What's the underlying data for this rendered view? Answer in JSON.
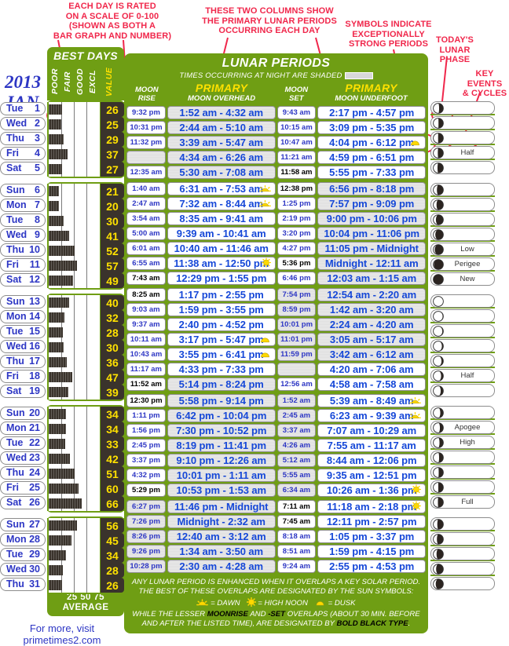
{
  "annotations": [
    {
      "id": "rating-note",
      "text": "EACH DAY IS RATED\nON A SCALE OF 0-100\n(SHOWN AS BOTH A\nBAR GRAPH AND NUMBER)"
    },
    {
      "id": "columns-note",
      "text": "THESE TWO COLUMNS SHOW\nTHE PRIMARY LUNAR PERIODS\nOCCURRING EACH DAY"
    },
    {
      "id": "symbols-note",
      "text": "SYMBOLS INDICATE\nEXCEPTIONALLY\nSTRONG PERIODS"
    },
    {
      "id": "todays-phase-note",
      "text": "TODAY'S\nLUNAR\nPHASE"
    },
    {
      "id": "key-events-note",
      "text": "KEY\nEVENTS\n& CYCLES"
    }
  ],
  "left": {
    "year": "2013",
    "month": "JAN",
    "best_days_title": "BEST DAYS",
    "column_headers": [
      "POOR",
      "FAIR",
      "GOOD",
      "EXCL",
      "VALUE"
    ],
    "axis_labels": "25 50 75",
    "axis_caption": "AVERAGE",
    "footer_line1": "For more, visit",
    "footer_line2": "primetimes2.com"
  },
  "main": {
    "title": "LUNAR PERIODS",
    "subtitle": "TIMES OCCURRING AT NIGHT ARE SHADED",
    "headers": {
      "moon_rise": "MOON\nRISE",
      "moon_rise_l1": "MOON",
      "moon_rise_l2": "RISE",
      "overhead_big": "PRIMARY",
      "overhead_small": "MOON OVERHEAD",
      "moon_set_l1": "MOON",
      "moon_set_l2": "SET",
      "underfoot_big": "PRIMARY",
      "underfoot_small": "MOON UNDERFOOT"
    },
    "footnote_line1": "ANY LUNAR PERIOD IS ENHANCED WHEN IT OVERLAPS A KEY SOLAR PERIOD.",
    "footnote_line2": "THE BEST OF THESE OVERLAPS ARE DESIGNATED BY THE SUN SYMBOLS:",
    "legend_dawn": "= DAWN",
    "legend_noon": "= HIGH NOON",
    "legend_dusk": "= DUSK",
    "footnote_line3a": "WHILE THE LESSER ",
    "footnote_line3b": "MOONRISE",
    "footnote_line3c": " AND ",
    "footnote_line3d": "-SET",
    "footnote_line3e": " OVERLAPS (ABOUT 30 MIN. BEFORE",
    "footnote_line4a": "AND AFTER THE LISTED TIME), ARE DESIGNATED BY ",
    "footnote_line4b": "BOLD BLACK TYPE",
    "footnote_line4c": "."
  },
  "colors": {
    "green": "#6f9e14",
    "red_annotation": "#f0274b",
    "blue_text": "#1648d8",
    "dark_bar": "#3a332c",
    "yellow_value": "#ffe100",
    "shade_gray": "#dedede"
  },
  "weeks": [
    {
      "days": [
        {
          "day": "Tue",
          "num": "1",
          "value": 26,
          "rise": "9:32 pm",
          "rise_bold": false,
          "rise_shaded": false,
          "overhead": "1:52 am - 4:32 am",
          "overhead_shaded": true,
          "overhead_sym": "",
          "set": "9:43 am",
          "set_bold": false,
          "set_shaded": false,
          "underfoot": "2:17 pm - 4:57 pm",
          "underfoot_shaded": false,
          "underfoot_sym": "",
          "phase": 0.58,
          "event": ""
        },
        {
          "day": "Wed",
          "num": "2",
          "value": 25,
          "rise": "10:31 pm",
          "rise_bold": false,
          "rise_shaded": false,
          "overhead": "2:44 am - 5:10 am",
          "overhead_shaded": true,
          "overhead_sym": "",
          "set": "10:15 am",
          "set_bold": false,
          "set_shaded": false,
          "underfoot": "3:09 pm - 5:35 pm",
          "underfoot_shaded": false,
          "underfoot_sym": "",
          "phase": 0.52,
          "event": ""
        },
        {
          "day": "Thu",
          "num": "3",
          "value": 29,
          "rise": "11:32 pm",
          "rise_bold": false,
          "rise_shaded": false,
          "overhead": "3:39 am - 5:47 am",
          "overhead_shaded": true,
          "overhead_sym": "",
          "set": "10:47 am",
          "set_bold": false,
          "set_shaded": false,
          "underfoot": "4:04 pm - 6:12 pm",
          "underfoot_shaded": false,
          "underfoot_sym": "dusk",
          "phase": 0.48,
          "event": ""
        },
        {
          "day": "Fri",
          "num": "4",
          "value": 37,
          "rise": "",
          "rise_bold": false,
          "rise_shaded": true,
          "overhead": "4:34 am - 6:26 am",
          "overhead_shaded": true,
          "overhead_sym": "",
          "set": "11:21 am",
          "set_bold": false,
          "set_shaded": false,
          "underfoot": "4:59 pm - 6:51 pm",
          "underfoot_shaded": false,
          "underfoot_sym": "",
          "phase": 0.45,
          "event": "Half"
        },
        {
          "day": "Sat",
          "num": "5",
          "value": 27,
          "rise": "12:35 am",
          "rise_bold": false,
          "rise_shaded": false,
          "overhead": "5:30 am - 7:08 am",
          "overhead_shaded": true,
          "overhead_sym": "",
          "set": "11:58 am",
          "set_bold": true,
          "set_shaded": false,
          "underfoot": "5:55 pm - 7:33 pm",
          "underfoot_shaded": false,
          "underfoot_sym": "",
          "phase": 0.42,
          "event": ""
        }
      ]
    },
    {
      "days": [
        {
          "day": "Sun",
          "num": "6",
          "value": 21,
          "rise": "1:40 am",
          "rise_bold": false,
          "rise_shaded": false,
          "overhead": "6:31 am - 7:53 am",
          "overhead_shaded": false,
          "overhead_sym": "dawn",
          "set": "12:38 pm",
          "set_bold": true,
          "set_shaded": false,
          "underfoot": "6:56 pm - 8:18 pm",
          "underfoot_shaded": true,
          "underfoot_sym": "",
          "phase": 0.36,
          "event": ""
        },
        {
          "day": "Mon",
          "num": "7",
          "value": 20,
          "rise": "2:47 am",
          "rise_bold": false,
          "rise_shaded": false,
          "overhead": "7:32 am - 8:44 am",
          "overhead_shaded": false,
          "overhead_sym": "dawn",
          "set": "1:25 pm",
          "set_bold": false,
          "set_shaded": false,
          "underfoot": "7:57 pm - 9:09 pm",
          "underfoot_shaded": true,
          "underfoot_sym": "",
          "phase": 0.32,
          "event": ""
        },
        {
          "day": "Tue",
          "num": "8",
          "value": 30,
          "rise": "3:54 am",
          "rise_bold": false,
          "rise_shaded": false,
          "overhead": "8:35 am - 9:41 am",
          "overhead_shaded": false,
          "overhead_sym": "",
          "set": "2:19 pm",
          "set_bold": false,
          "set_shaded": false,
          "underfoot": "9:00 pm - 10:06 pm",
          "underfoot_shaded": true,
          "underfoot_sym": "",
          "phase": 0.26,
          "event": ""
        },
        {
          "day": "Wed",
          "num": "9",
          "value": 41,
          "rise": "5:00 am",
          "rise_bold": false,
          "rise_shaded": false,
          "overhead": "9:39 am - 10:41 am",
          "overhead_shaded": false,
          "overhead_sym": "",
          "set": "3:20 pm",
          "set_bold": false,
          "set_shaded": false,
          "underfoot": "10:04 pm - 11:06 pm",
          "underfoot_shaded": true,
          "underfoot_sym": "",
          "phase": 0.2,
          "event": ""
        },
        {
          "day": "Thu",
          "num": "10",
          "value": 52,
          "rise": "6:01 am",
          "rise_bold": false,
          "rise_shaded": false,
          "overhead": "10:40 am - 11:46 am",
          "overhead_shaded": false,
          "overhead_sym": "",
          "set": "4:27 pm",
          "set_bold": false,
          "set_shaded": false,
          "underfoot": "11:05 pm - Midnight",
          "underfoot_shaded": true,
          "underfoot_sym": "",
          "phase": 0.14,
          "event": "Low"
        },
        {
          "day": "Fri",
          "num": "11",
          "value": 57,
          "rise": "6:55 am",
          "rise_bold": false,
          "rise_shaded": false,
          "overhead": "11:38 am - 12:50 pm",
          "overhead_shaded": false,
          "overhead_sym": "noon",
          "set": "5:36 pm",
          "set_bold": true,
          "set_shaded": false,
          "underfoot": "Midnight - 12:11 am",
          "underfoot_shaded": true,
          "underfoot_sym": "",
          "phase": 0.06,
          "event": "Perigee"
        },
        {
          "day": "Sat",
          "num": "12",
          "value": 49,
          "rise": "7:43 am",
          "rise_bold": true,
          "rise_shaded": false,
          "overhead": "12:29 pm - 1:55 pm",
          "overhead_shaded": false,
          "overhead_sym": "",
          "set": "6:46 pm",
          "set_bold": false,
          "set_shaded": false,
          "underfoot": "12:03 am - 1:15 am",
          "underfoot_shaded": true,
          "underfoot_sym": "",
          "phase": 0.03,
          "event": "New"
        }
      ]
    },
    {
      "days": [
        {
          "day": "Sun",
          "num": "13",
          "value": 40,
          "rise": "8:25 am",
          "rise_bold": true,
          "rise_shaded": false,
          "overhead": "1:17 pm - 2:55 pm",
          "overhead_shaded": false,
          "overhead_sym": "",
          "set": "7:54 pm",
          "set_bold": false,
          "set_shaded": true,
          "underfoot": "12:54 am - 2:20 am",
          "underfoot_shaded": true,
          "underfoot_sym": "",
          "phase": 0.96,
          "event": ""
        },
        {
          "day": "Mon",
          "num": "14",
          "value": 32,
          "rise": "9:03 am",
          "rise_bold": false,
          "rise_shaded": false,
          "overhead": "1:59 pm - 3:55 pm",
          "overhead_shaded": false,
          "overhead_sym": "",
          "set": "8:59 pm",
          "set_bold": false,
          "set_shaded": true,
          "underfoot": "1:42 am - 3:20 am",
          "underfoot_shaded": true,
          "underfoot_sym": "",
          "phase": 0.93,
          "event": ""
        },
        {
          "day": "Tue",
          "num": "15",
          "value": 28,
          "rise": "9:37 am",
          "rise_bold": false,
          "rise_shaded": false,
          "overhead": "2:40 pm - 4:52 pm",
          "overhead_shaded": false,
          "overhead_sym": "",
          "set": "10:01 pm",
          "set_bold": false,
          "set_shaded": true,
          "underfoot": "2:24 am - 4:20 am",
          "underfoot_shaded": true,
          "underfoot_sym": "",
          "phase": 0.9,
          "event": ""
        },
        {
          "day": "Wed",
          "num": "16",
          "value": 30,
          "rise": "10:11 am",
          "rise_bold": false,
          "rise_shaded": false,
          "overhead": "3:17 pm - 5:47 pm",
          "overhead_shaded": false,
          "overhead_sym": "dusk",
          "set": "11:01 pm",
          "set_bold": false,
          "set_shaded": true,
          "underfoot": "3:05 am - 5:17 am",
          "underfoot_shaded": true,
          "underfoot_sym": "",
          "phase": 0.86,
          "event": ""
        },
        {
          "day": "Thu",
          "num": "17",
          "value": 36,
          "rise": "10:43 am",
          "rise_bold": false,
          "rise_shaded": false,
          "overhead": "3:55 pm - 6:41 pm",
          "overhead_shaded": false,
          "overhead_sym": "dusk",
          "set": "11:59 pm",
          "set_bold": false,
          "set_shaded": true,
          "underfoot": "3:42 am - 6:12 am",
          "underfoot_shaded": true,
          "underfoot_sym": "",
          "phase": 0.82,
          "event": ""
        },
        {
          "day": "Fri",
          "num": "18",
          "value": 47,
          "rise": "11:17 am",
          "rise_bold": false,
          "rise_shaded": false,
          "overhead": "4:33 pm - 7:33 pm",
          "overhead_shaded": false,
          "overhead_sym": "",
          "set": "",
          "set_bold": false,
          "set_shaded": true,
          "underfoot": "4:20 am - 7:06 am",
          "underfoot_shaded": false,
          "underfoot_sym": "",
          "phase": 0.78,
          "event": "Half"
        },
        {
          "day": "Sat",
          "num": "19",
          "value": 39,
          "rise": "11:52 am",
          "rise_bold": true,
          "rise_shaded": false,
          "overhead": "5:14 pm - 8:24 pm",
          "overhead_shaded": true,
          "overhead_sym": "",
          "set": "12:56 am",
          "set_bold": false,
          "set_shaded": false,
          "underfoot": "4:58 am - 7:58 am",
          "underfoot_shaded": false,
          "underfoot_sym": "",
          "phase": 0.74,
          "event": ""
        }
      ]
    },
    {
      "days": [
        {
          "day": "Sun",
          "num": "20",
          "value": 34,
          "rise": "12:30 pm",
          "rise_bold": true,
          "rise_shaded": false,
          "overhead": "5:58 pm - 9:14 pm",
          "overhead_shaded": true,
          "overhead_sym": "",
          "set": "1:52 am",
          "set_bold": false,
          "set_shaded": true,
          "underfoot": "5:39 am - 8:49 am",
          "underfoot_shaded": false,
          "underfoot_sym": "dawn",
          "phase": 0.7,
          "event": ""
        },
        {
          "day": "Mon",
          "num": "21",
          "value": 34,
          "rise": "1:11 pm",
          "rise_bold": false,
          "rise_shaded": false,
          "overhead": "6:42 pm - 10:04 pm",
          "overhead_shaded": true,
          "overhead_sym": "",
          "set": "2:45 am",
          "set_bold": false,
          "set_shaded": true,
          "underfoot": "6:23 am - 9:39 am",
          "underfoot_shaded": false,
          "underfoot_sym": "dawn",
          "phase": 0.66,
          "event": "Apogee"
        },
        {
          "day": "Tue",
          "num": "22",
          "value": 33,
          "rise": "1:56 pm",
          "rise_bold": false,
          "rise_shaded": false,
          "overhead": "7:30 pm - 10:52 pm",
          "overhead_shaded": true,
          "overhead_sym": "",
          "set": "3:37 am",
          "set_bold": false,
          "set_shaded": true,
          "underfoot": "7:07 am - 10:29 am",
          "underfoot_shaded": false,
          "underfoot_sym": "",
          "phase": 0.62,
          "event": "High"
        },
        {
          "day": "Wed",
          "num": "23",
          "value": 42,
          "rise": "2:45 pm",
          "rise_bold": false,
          "rise_shaded": false,
          "overhead": "8:19 pm - 11:41 pm",
          "overhead_shaded": true,
          "overhead_sym": "",
          "set": "4:26 am",
          "set_bold": false,
          "set_shaded": true,
          "underfoot": "7:55 am - 11:17 am",
          "underfoot_shaded": false,
          "underfoot_sym": "",
          "phase": 0.58,
          "event": ""
        },
        {
          "day": "Thu",
          "num": "24",
          "value": 51,
          "rise": "3:37 pm",
          "rise_bold": false,
          "rise_shaded": false,
          "overhead": "9:10 pm - 12:26 am",
          "overhead_shaded": true,
          "overhead_sym": "",
          "set": "5:12 am",
          "set_bold": false,
          "set_shaded": true,
          "underfoot": "8:44 am - 12:06 pm",
          "underfoot_shaded": false,
          "underfoot_sym": "",
          "phase": 0.54,
          "event": ""
        },
        {
          "day": "Fri",
          "num": "25",
          "value": 60,
          "rise": "4:32 pm",
          "rise_bold": false,
          "rise_shaded": false,
          "overhead": "10:01 pm - 1:11 am",
          "overhead_shaded": true,
          "overhead_sym": "",
          "set": "5:55 am",
          "set_bold": false,
          "set_shaded": true,
          "underfoot": "9:35 am - 12:51 pm",
          "underfoot_shaded": false,
          "underfoot_sym": "",
          "phase": 0.5,
          "event": ""
        },
        {
          "day": "Sat",
          "num": "26",
          "value": 66,
          "rise": "5:29 pm",
          "rise_bold": true,
          "rise_shaded": false,
          "overhead": "10:53 pm - 1:53 am",
          "overhead_shaded": true,
          "overhead_sym": "",
          "set": "6:34 am",
          "set_bold": false,
          "set_shaded": true,
          "underfoot": "10:26 am - 1:36 pm",
          "underfoot_shaded": false,
          "underfoot_sym": "noon",
          "phase": 0.46,
          "event": "Full"
        }
      ]
    },
    {
      "days": [
        {
          "day": "Sun",
          "num": "27",
          "value": 56,
          "rise": "6:27 pm",
          "rise_bold": false,
          "rise_shaded": true,
          "overhead": "11:46 pm - Midnight",
          "overhead_shaded": true,
          "overhead_sym": "",
          "set": "7:11 am",
          "set_bold": true,
          "set_shaded": false,
          "underfoot": "11:18 am - 2:18 pm",
          "underfoot_shaded": false,
          "underfoot_sym": "noon",
          "phase": 0.4,
          "event": ""
        },
        {
          "day": "Mon",
          "num": "28",
          "value": 45,
          "rise": "7:26 pm",
          "rise_bold": false,
          "rise_shaded": true,
          "overhead": "Midnight - 2:32 am",
          "overhead_shaded": true,
          "overhead_sym": "",
          "set": "7:45 am",
          "set_bold": true,
          "set_shaded": false,
          "underfoot": "12:11 pm - 2:57 pm",
          "underfoot_shaded": false,
          "underfoot_sym": "",
          "phase": 0.36,
          "event": ""
        },
        {
          "day": "Tue",
          "num": "29",
          "value": 34,
          "rise": "8:26 pm",
          "rise_bold": false,
          "rise_shaded": true,
          "overhead": "12:40 am - 3:12 am",
          "overhead_shaded": true,
          "overhead_sym": "",
          "set": "8:18 am",
          "set_bold": false,
          "set_shaded": false,
          "underfoot": "1:05 pm - 3:37 pm",
          "underfoot_shaded": false,
          "underfoot_sym": "",
          "phase": 0.32,
          "event": ""
        },
        {
          "day": "Wed",
          "num": "30",
          "value": 28,
          "rise": "9:26 pm",
          "rise_bold": false,
          "rise_shaded": true,
          "overhead": "1:34 am - 3:50 am",
          "overhead_shaded": true,
          "overhead_sym": "",
          "set": "8:51 am",
          "set_bold": false,
          "set_shaded": false,
          "underfoot": "1:59 pm - 4:15 pm",
          "underfoot_shaded": false,
          "underfoot_sym": "",
          "phase": 0.28,
          "event": ""
        },
        {
          "day": "Thu",
          "num": "31",
          "value": 26,
          "rise": "10:28 pm",
          "rise_bold": false,
          "rise_shaded": true,
          "overhead": "2:30 am - 4:28 am",
          "overhead_shaded": true,
          "overhead_sym": "",
          "set": "9:24 am",
          "set_bold": false,
          "set_shaded": false,
          "underfoot": "2:55 pm - 4:53 pm",
          "underfoot_shaded": false,
          "underfoot_sym": "",
          "phase": 0.24,
          "event": ""
        }
      ]
    }
  ]
}
